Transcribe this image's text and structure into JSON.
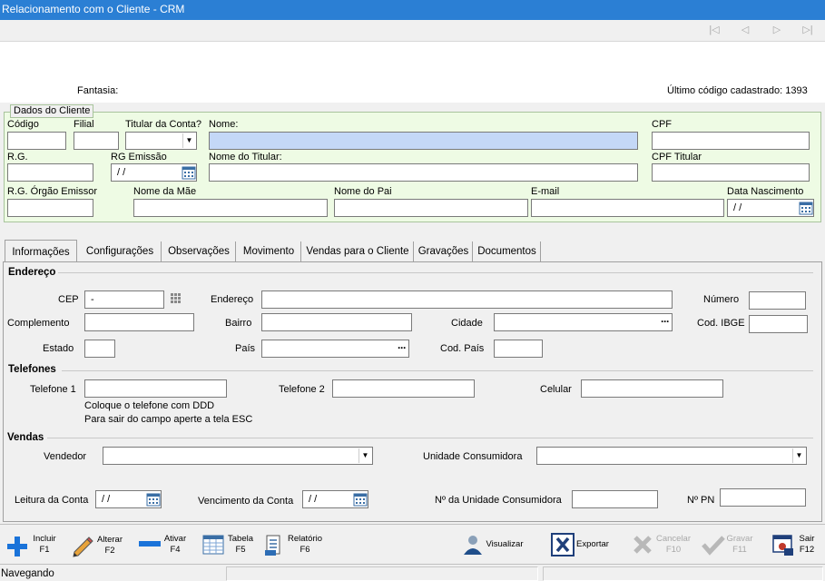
{
  "window": {
    "title": "Relacionamento com o Cliente - CRM"
  },
  "header": {
    "fantasia_label": "Fantasia:",
    "ultimo_codigo_label": "Último código cadastrado: 1393"
  },
  "dados_cliente": {
    "legend": "Dados do Cliente",
    "codigo_label": "Código",
    "filial_label": "Filial",
    "titular_conta_label": "Titular da Conta?",
    "nome_label": "Nome:",
    "cpf_label": "CPF",
    "rg_label": "R.G.",
    "rg_emissao_label": "RG Emissão",
    "rg_emissao_value": "/ /",
    "nome_titular_label": "Nome do Titular:",
    "cpf_titular_label": "CPF Titular",
    "rg_orgao_label": "R.G. Órgão Emissor",
    "nome_mae_label": "Nome da Mãe",
    "nome_pai_label": "Nome do Pai",
    "email_label": "E-mail",
    "data_nascimento_label": "Data Nascimento",
    "data_nascimento_value": "/ /"
  },
  "tabs": [
    {
      "label": "Informações"
    },
    {
      "label": "Configurações"
    },
    {
      "label": "Observações"
    },
    {
      "label": "Movimento"
    },
    {
      "label": "Vendas para o Cliente"
    },
    {
      "label": "Gravações"
    },
    {
      "label": "Documentos"
    }
  ],
  "endereco": {
    "title": "Endereço",
    "cep_label": "CEP",
    "cep_value": "-",
    "endereco_label": "Endereço",
    "numero_label": "Número",
    "complemento_label": "Complemento",
    "bairro_label": "Bairro",
    "cidade_label": "Cidade",
    "cod_ibge_label": "Cod. IBGE",
    "estado_label": "Estado",
    "pais_label": "País",
    "cod_pais_label": "Cod. País"
  },
  "telefones": {
    "title": "Telefones",
    "telefone1_label": "Telefone 1",
    "telefone2_label": "Telefone 2",
    "celular_label": "Celular",
    "hint1": "Coloque o telefone com DDD",
    "hint2": "Para sair do campo aperte a tela ESC"
  },
  "vendas": {
    "title": "Vendas",
    "vendedor_label": "Vendedor",
    "unidade_consumidora_label": "Unidade Consumidora",
    "leitura_conta_label": "Leitura da Conta",
    "leitura_conta_value": "/ /",
    "vencimento_conta_label": "Vencimento da Conta",
    "vencimento_conta_value": "/ /",
    "num_unidade_label": "Nº da Unidade Consumidora",
    "num_pn_label": "Nº PN"
  },
  "toolbar": {
    "incluir": "Incluir",
    "incluir_key": "F1",
    "alterar": "Alterar",
    "alterar_key": "F2",
    "ativar": "Ativar",
    "ativar_key": "F4",
    "tabela": "Tabela",
    "tabela_key": "F5",
    "relatorio": "Relatório",
    "relatorio_key": "F6",
    "visualizar": "Visualizar",
    "exportar": "Exportar",
    "cancelar": "Cancelar",
    "cancelar_key": "F10",
    "gravar": "Gravar",
    "gravar_key": "F11",
    "sair": "Sair",
    "sair_key": "F12"
  },
  "status": {
    "text": "Navegando"
  },
  "colors": {
    "titlebar": "#2b7fd4",
    "green_panel": "#eefbe4",
    "selected_field": "#c4d8f7"
  }
}
